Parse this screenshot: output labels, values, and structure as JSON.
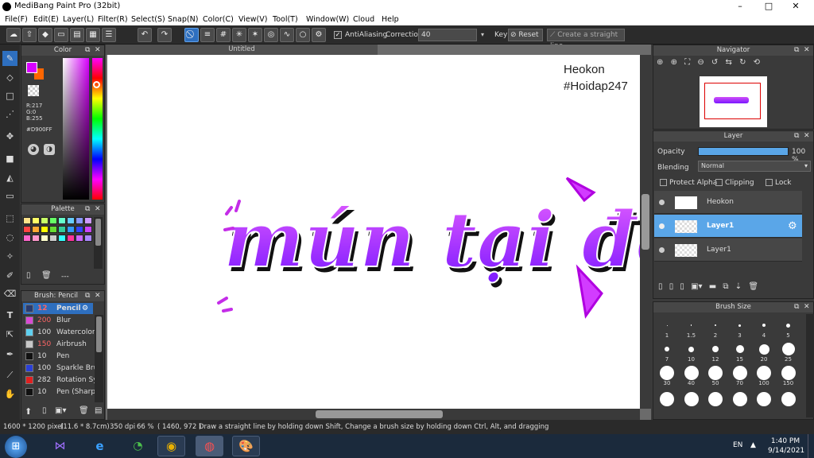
{
  "window": {
    "title": "MediBang Paint Pro (32bit)",
    "minimize": "–",
    "maximize": "□",
    "close": "✕"
  },
  "menu": [
    "File(F)",
    "Edit(E)",
    "Layer(L)",
    "Filter(R)",
    "Select(S)",
    "Snap(N)",
    "Color(C)",
    "View(V)",
    "Tool(T)",
    "Window(W)",
    "Cloud",
    "Help"
  ],
  "toolbar": {
    "antialiasing": "AntiAliasing",
    "correction_label": "Correction",
    "correction_value": "40",
    "key_label": "Key",
    "reset": "Reset",
    "straight_line": "Create a straight line"
  },
  "color_panel": {
    "title": "Color",
    "r": "R:217",
    "g": "G:0",
    "b": "B:255",
    "hex": "#D900FF",
    "primary": "#D900FF",
    "secondary": "#FF6600"
  },
  "palette_panel": {
    "title": "Palette",
    "footer": "---"
  },
  "brush_panel": {
    "title": "Brush: Pencil",
    "items": [
      {
        "size": "12",
        "name": "Pencil",
        "color": "#2a3b6e",
        "size_color": "#ff6666"
      },
      {
        "size": "200",
        "name": "Blur",
        "color": "#d94ad4",
        "size_color": "#ff6666"
      },
      {
        "size": "100",
        "name": "Watercolor",
        "color": "#5fd0f0",
        "size_color": "#dddddd"
      },
      {
        "size": "150",
        "name": "Airbrush",
        "color": "#c8c8c8",
        "size_color": "#ff6666"
      },
      {
        "size": "10",
        "name": "Pen",
        "color": "#111111",
        "size_color": "#dddddd"
      },
      {
        "size": "100",
        "name": "Sparkle Bru",
        "color": "#2a40d8",
        "size_color": "#dddddd"
      },
      {
        "size": "282",
        "name": "Rotation Sy",
        "color": "#e02020",
        "size_color": "#dddddd"
      },
      {
        "size": "10",
        "name": "Pen (Sharp",
        "color": "#111111",
        "size_color": "#dddddd"
      }
    ]
  },
  "document": {
    "tab": "Untitled",
    "watermark_line1": "Heokon",
    "watermark_line2": "#Hoidap247",
    "lettering": "mún tại đô"
  },
  "navigator": {
    "title": "Navigator"
  },
  "layer_panel": {
    "title": "Layer",
    "opacity_label": "Opacity",
    "opacity_value": "100 %",
    "opacity_level": 1.0,
    "blending_label": "Blending",
    "blending_value": "Normal",
    "protect_alpha": "Protect Alpha",
    "clipping": "Clipping",
    "lock": "Lock",
    "layers": [
      {
        "name": "Heokon",
        "selected": false
      },
      {
        "name": "Layer1",
        "selected": true
      },
      {
        "name": "Layer1",
        "selected": false
      }
    ]
  },
  "brush_size_panel": {
    "title": "Brush Size",
    "sizes": [
      "1",
      "1.5",
      "2",
      "3",
      "4",
      "5",
      "7",
      "10",
      "12",
      "15",
      "20",
      "25",
      "30",
      "40",
      "50",
      "70",
      "100",
      "150"
    ]
  },
  "status": {
    "dimensions": "1600 * 1200 pixel",
    "physical": "(11.6 * 8.7cm)",
    "dpi": "350 dpi",
    "zoom": "66 %",
    "coords": "( 1460, 972 )",
    "hint": "Draw a straight line by holding down Shift, Change a brush size by holding down Ctrl, Alt, and dragging"
  },
  "taskbar": {
    "lang": "EN",
    "time": "1:40 PM",
    "date": "9/14/2021"
  }
}
